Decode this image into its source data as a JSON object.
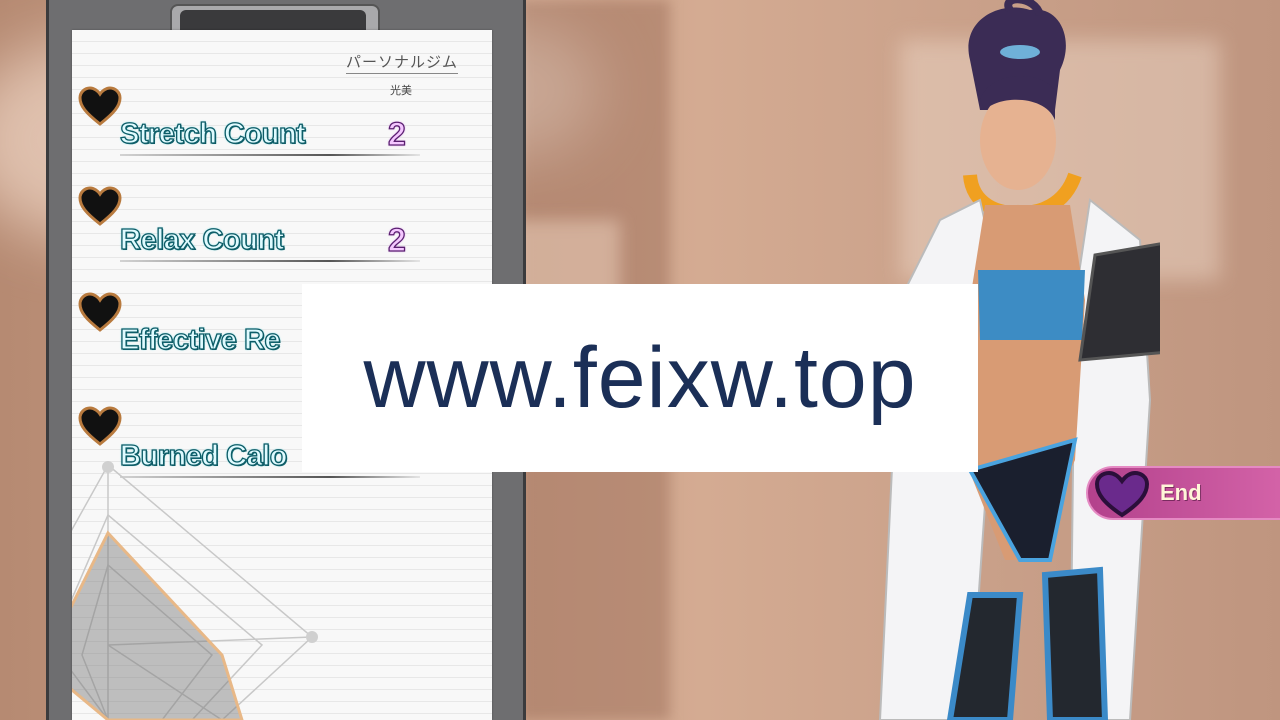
{
  "clipboard": {
    "gym_name": "パーソナルジム",
    "trainer_name": "光美",
    "stats": [
      {
        "label": "Stretch Count",
        "value": "2"
      },
      {
        "label": "Relax  Count",
        "value": "2"
      },
      {
        "label": "Effective Re",
        "value": ""
      },
      {
        "label": "Burned Calo",
        "value": ""
      }
    ]
  },
  "watermark": {
    "text": "www.feixw.top"
  },
  "end_button": {
    "label": "End"
  },
  "colors": {
    "stat_label": "#dffbff",
    "stat_value": "#f4c7ff",
    "end_button": "#c24f9b",
    "watermark_text": "#1b2f57"
  },
  "icons": [
    "heart-icon",
    "end-heart-icon"
  ]
}
